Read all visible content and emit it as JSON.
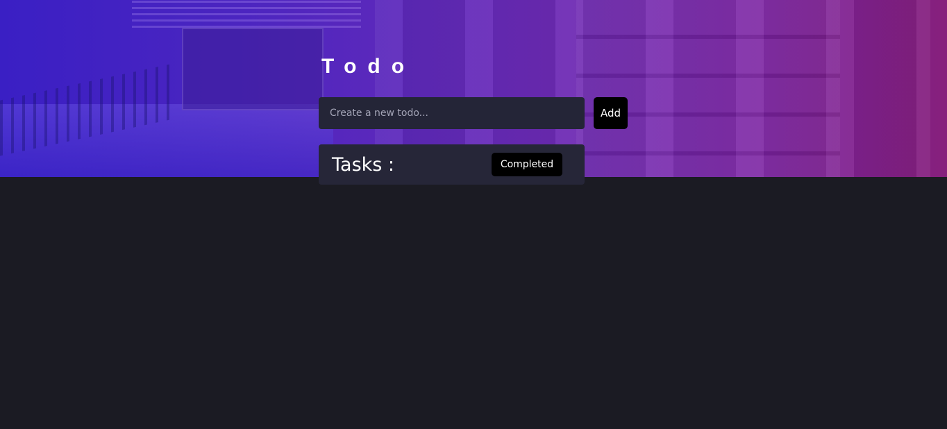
{
  "app": {
    "title": "Todo"
  },
  "new_todo": {
    "placeholder": "Create a new todo...",
    "value": "",
    "add_label": "Add"
  },
  "tasks": {
    "heading": "Tasks :",
    "completed_label": "Completed",
    "items": []
  },
  "colors": {
    "background": "#1b1b23",
    "panel": "#262638",
    "input": "#242537",
    "button": "#000000",
    "hero_gradient_start": "#3a1fc4",
    "hero_gradient_end": "#86207c"
  }
}
